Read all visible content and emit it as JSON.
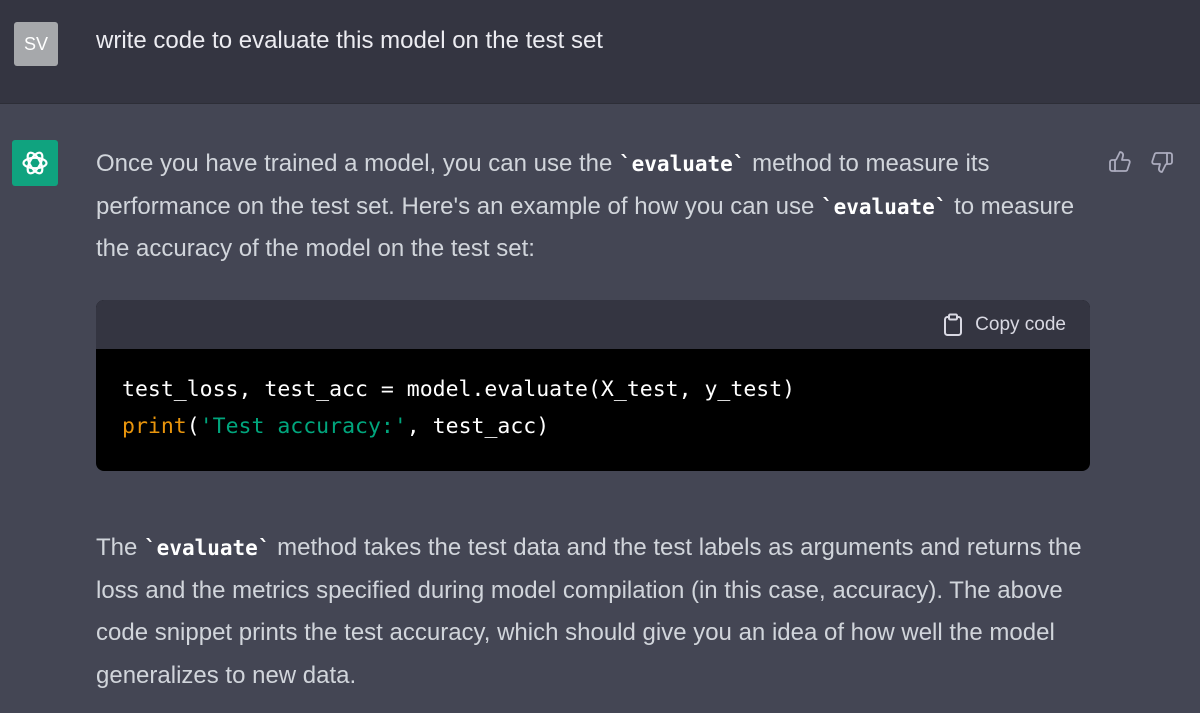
{
  "user_message": {
    "avatar_initials": "SV",
    "text": "write code to evaluate this model on the test set"
  },
  "assistant_message": {
    "avatar_icon": "openai-logo-icon",
    "paragraph1": {
      "t1": "Once you have trained a model, you can use the ",
      "c1": "`evaluate`",
      "t2": " method to measure its performance on the test set. Here's an example of how you can use ",
      "c2": "`evaluate`",
      "t3": " to measure the accuracy of the model on the test set:"
    },
    "code_block": {
      "copy_label": "Copy code",
      "line1": "test_loss, test_acc = model.evaluate(X_test, y_test)",
      "line2": {
        "builtin": "print",
        "open": "(",
        "string": "'Test accuracy:'",
        "rest": ", test_acc)"
      }
    },
    "paragraph2": {
      "t1": "The ",
      "c1": "`evaluate`",
      "t2": " method takes the test data and the test labels as arguments and returns the loss and the metrics specified during model compilation (in this case, accuracy). The above code snippet prints the test accuracy, which should give you an idea of how well the model generalizes to new data."
    },
    "feedback": {
      "thumbs_up_icon": "thumbs-up-icon",
      "thumbs_down_icon": "thumbs-down-icon"
    }
  },
  "colors": {
    "user_bg": "#343541",
    "assistant_bg": "#444654",
    "brand_green": "#10a37f",
    "code_bg": "#000000",
    "code_header_bg": "#343541",
    "builtin": "#e9950c",
    "string": "#00a67d"
  }
}
